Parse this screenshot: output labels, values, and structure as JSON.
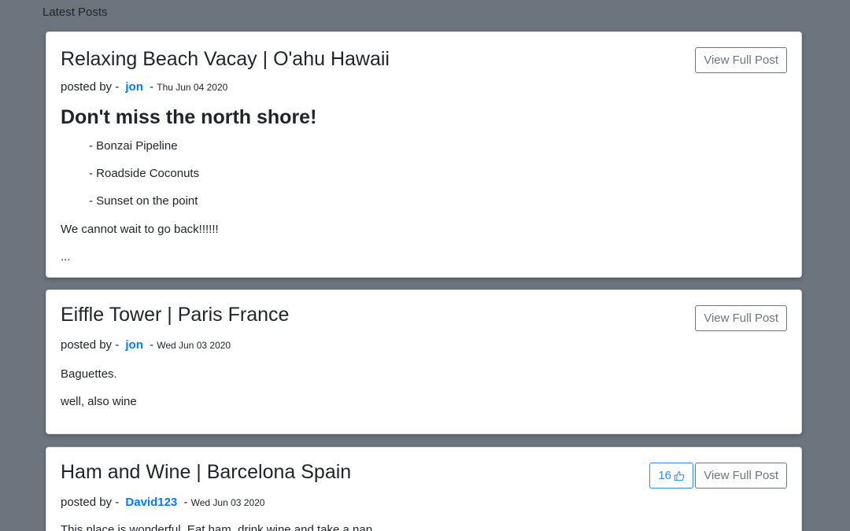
{
  "section": {
    "label": "Latest Posts"
  },
  "posts": [
    {
      "title": "Relaxing Beach Vacay | O'ahu Hawaii",
      "posted_by_prefix": "posted by -",
      "author": "jon",
      "date_sep": "-",
      "date": "Thu Jun 04 2020",
      "view_label": "View Full Post",
      "heading": "Don't miss the north shore!",
      "list": [
        "- Bonzai Pipeline",
        "- Roadside Coconuts",
        "- Sunset on the point"
      ],
      "paragraphs": [
        "We cannot wait to go back!!!!!!",
        "..."
      ]
    },
    {
      "title": "Eiffle Tower | Paris France",
      "posted_by_prefix": "posted by -",
      "author": "jon",
      "date_sep": "-",
      "date": "Wed Jun 03 2020",
      "view_label": "View Full Post",
      "paragraphs": [
        "Baguettes.",
        "well, also wine"
      ]
    },
    {
      "title": "Ham and Wine | Barcelona Spain",
      "posted_by_prefix": "posted by -",
      "author": "David123",
      "date_sep": "-",
      "date": "Wed Jun 03 2020",
      "view_label": "View Full Post",
      "like_count": "16",
      "like_icon": "thumbs-up-icon",
      "paragraphs": [
        "This place is wonderful.  Eat ham, drink wine and take a nap."
      ]
    }
  ],
  "colors": {
    "background": "#6c757d",
    "link": "#007bff",
    "like_accent": "#2f8cf7",
    "secondary": "#6c757d"
  }
}
